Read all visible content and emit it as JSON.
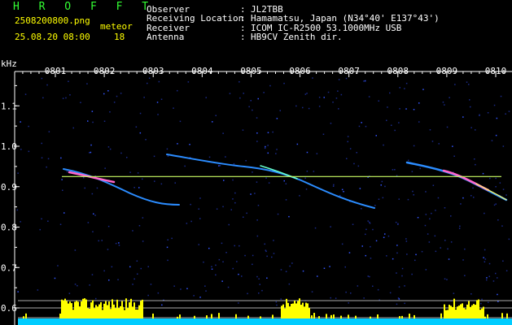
{
  "header": {
    "app_name": "H R O F F T",
    "filename": "2508200800.png",
    "datetime": "25.08.20 08:00",
    "count_label": "meteor",
    "count_value": "18",
    "info": [
      {
        "label": "Observer",
        "value": "JL2TBB"
      },
      {
        "label": "Receiving Location",
        "value": "Hamamatsu, Japan (N34°40' E137°43')"
      },
      {
        "label": "Receiver",
        "value": "ICOM IC-R2500 53.1000MHz USB"
      },
      {
        "label": "Antenna",
        "value": "HB9CV Zenith dir."
      }
    ]
  },
  "chart_data": {
    "type": "heatmap",
    "ylabel": "kHz",
    "time_ticks": [
      "0801",
      "0802",
      "0803",
      "0804",
      "0805",
      "0806",
      "0807",
      "0808",
      "0809",
      "0810"
    ],
    "freq_ticks": [
      "1.1",
      "1.0",
      "0.9",
      "0.8",
      "0.7",
      "0.6"
    ],
    "carrier_khz": 0.925,
    "colors": {
      "background": "#000000",
      "text": "#ffffff",
      "header_accent": "#ffff00",
      "title": "#33ff33",
      "carrier": "#ccff66",
      "activity_bars": "#ffff00",
      "activity_base": "#00ccff"
    }
  }
}
